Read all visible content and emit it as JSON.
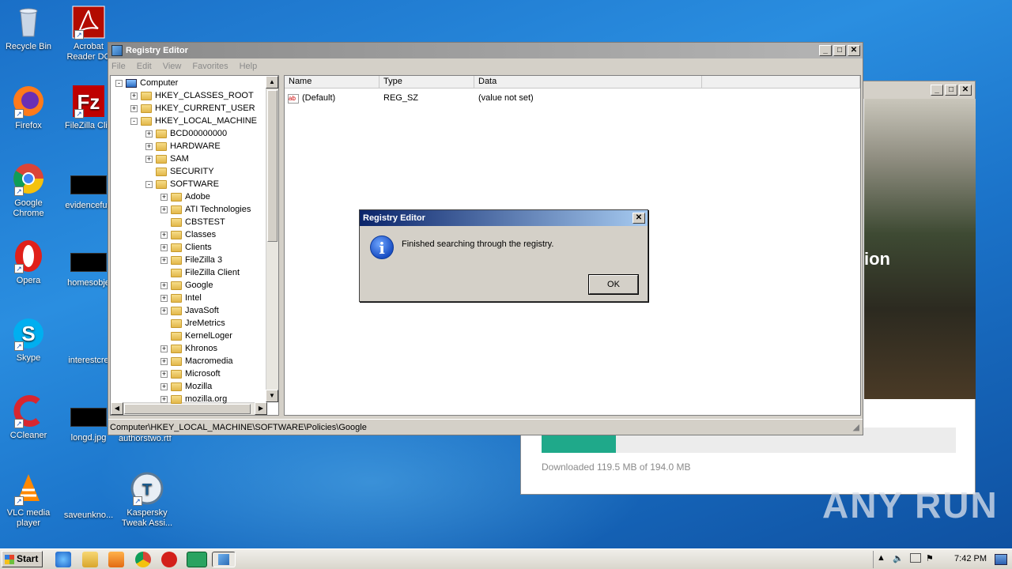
{
  "desktop": {
    "icons_col1": [
      {
        "label": "Recycle Bin",
        "icon": "recycle-bin-icon"
      },
      {
        "label": "Firefox",
        "icon": "firefox-icon"
      },
      {
        "label": "Google Chrome",
        "icon": "chrome-icon"
      },
      {
        "label": "Opera",
        "icon": "opera-icon"
      },
      {
        "label": "Skype",
        "icon": "skype-icon"
      },
      {
        "label": "CCleaner",
        "icon": "ccleaner-icon"
      },
      {
        "label": "VLC media player",
        "icon": "vlc-icon"
      }
    ],
    "icons_col2": [
      {
        "label": "Acrobat Reader DC",
        "icon": "acrobat-icon"
      },
      {
        "label": "FileZilla Clie",
        "icon": "filezilla-icon"
      },
      {
        "label": "evidencefud",
        "icon": "file-thumbnail-icon"
      },
      {
        "label": "homesobje",
        "icon": "file-thumbnail-icon"
      },
      {
        "label": "interestcre",
        "icon": "file-thumbnail-icon"
      },
      {
        "label": "longd.jpg",
        "icon": "file-thumbnail-icon"
      },
      {
        "label": "saveunkno...",
        "icon": "file-thumbnail-icon"
      }
    ],
    "extra_icons": [
      {
        "label": "Kaspersky Tweak Assi...",
        "icon": "kaspersky-icon"
      },
      {
        "label": "authorstwo.rtf",
        "icon": "rtf-icon"
      }
    ]
  },
  "registry": {
    "title": "Registry Editor",
    "menu": [
      "File",
      "Edit",
      "View",
      "Favorites",
      "Help"
    ],
    "tree": [
      {
        "label": "Computer",
        "level": 0,
        "exp": "-"
      },
      {
        "label": "HKEY_CLASSES_ROOT",
        "level": 1,
        "exp": "+"
      },
      {
        "label": "HKEY_CURRENT_USER",
        "level": 1,
        "exp": "+"
      },
      {
        "label": "HKEY_LOCAL_MACHINE",
        "level": 1,
        "exp": "-"
      },
      {
        "label": "BCD00000000",
        "level": 2,
        "exp": "+"
      },
      {
        "label": "HARDWARE",
        "level": 2,
        "exp": "+"
      },
      {
        "label": "SAM",
        "level": 2,
        "exp": "+"
      },
      {
        "label": "SECURITY",
        "level": 2,
        "exp": ""
      },
      {
        "label": "SOFTWARE",
        "level": 2,
        "exp": "-"
      },
      {
        "label": "Adobe",
        "level": 3,
        "exp": "+"
      },
      {
        "label": "ATI Technologies",
        "level": 3,
        "exp": "+"
      },
      {
        "label": "CBSTEST",
        "level": 3,
        "exp": ""
      },
      {
        "label": "Classes",
        "level": 3,
        "exp": "+"
      },
      {
        "label": "Clients",
        "level": 3,
        "exp": "+"
      },
      {
        "label": "FileZilla 3",
        "level": 3,
        "exp": "+"
      },
      {
        "label": "FileZilla Client",
        "level": 3,
        "exp": ""
      },
      {
        "label": "Google",
        "level": 3,
        "exp": "+"
      },
      {
        "label": "Intel",
        "level": 3,
        "exp": "+"
      },
      {
        "label": "JavaSoft",
        "level": 3,
        "exp": "+"
      },
      {
        "label": "JreMetrics",
        "level": 3,
        "exp": ""
      },
      {
        "label": "KernelLoger",
        "level": 3,
        "exp": ""
      },
      {
        "label": "Khronos",
        "level": 3,
        "exp": "+"
      },
      {
        "label": "Macromedia",
        "level": 3,
        "exp": "+"
      },
      {
        "label": "Microsoft",
        "level": 3,
        "exp": "+"
      },
      {
        "label": "Mozilla",
        "level": 3,
        "exp": "+"
      },
      {
        "label": "mozilla.org",
        "level": 3,
        "exp": "+"
      }
    ],
    "columns": [
      "Name",
      "Type",
      "Data"
    ],
    "value_row": {
      "name": "(Default)",
      "type": "REG_SZ",
      "data": "(value not set)"
    },
    "status_path": "Computer\\HKEY_LOCAL_MACHINE\\SOFTWARE\\Policies\\Google"
  },
  "dialog": {
    "title": "Registry Editor",
    "message": "Finished searching through the registry.",
    "ok_label": "OK",
    "close_glyph": "✕"
  },
  "download_window": {
    "banner_text": "ion",
    "progress_text": "Downloaded 119.5 MB of 194.0 MB",
    "progress_fraction": 0.1794
  },
  "taskbar": {
    "start_label": "Start",
    "clock": "7:42 PM",
    "tray_expand": "▲"
  },
  "watermark": "ANY RUN",
  "window_buttons": {
    "minimize": "_",
    "maximize": "□",
    "close": "✕"
  }
}
